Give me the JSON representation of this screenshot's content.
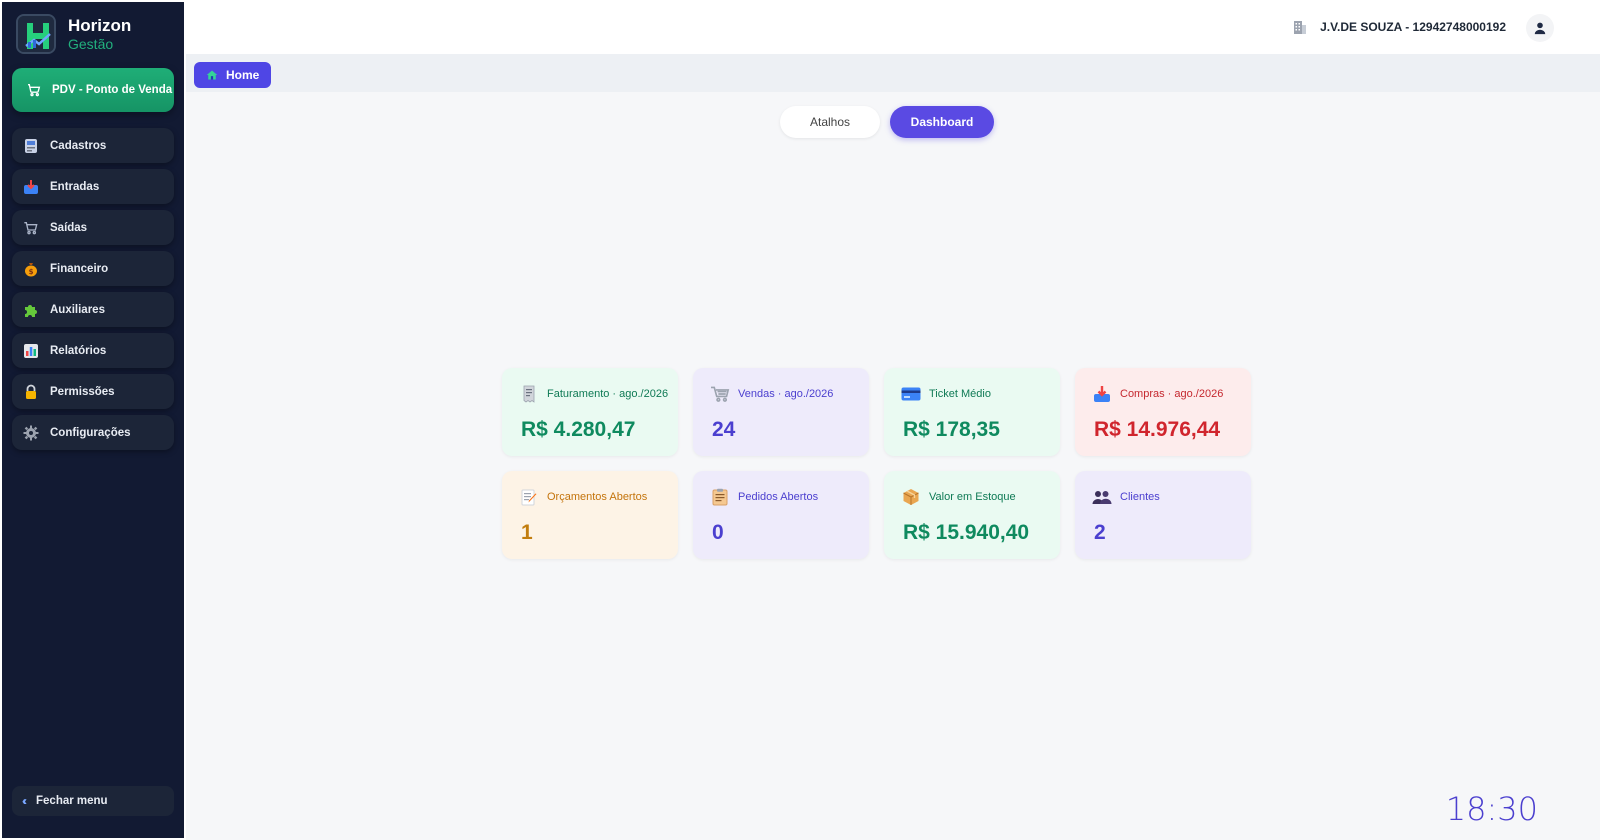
{
  "brand": {
    "name": "Horizon",
    "subtitle": "Gestão"
  },
  "sidebar": {
    "pdv_label": "PDV - Ponto de Venda",
    "items": [
      {
        "label": "Cadastros",
        "icon": "card-file-icon"
      },
      {
        "label": "Entradas",
        "icon": "inbox-icon"
      },
      {
        "label": "Saídas",
        "icon": "cart-icon"
      },
      {
        "label": "Financeiro",
        "icon": "money-bag-icon"
      },
      {
        "label": "Auxiliares",
        "icon": "puzzle-icon"
      },
      {
        "label": "Relatórios",
        "icon": "bar-chart-icon"
      },
      {
        "label": "Permissões",
        "icon": "lock-icon"
      },
      {
        "label": "Configurações",
        "icon": "gear-icon"
      }
    ],
    "close_label": "Fechar menu"
  },
  "topbar": {
    "company": "J.V.DE SOUZA - 12942748000192"
  },
  "breadcrumb": {
    "home_label": "Home"
  },
  "tabs": {
    "atalhos": "Atalhos",
    "dashboard": "Dashboard",
    "active": "Dashboard"
  },
  "cards": [
    {
      "label": "Faturamento · ago./2026",
      "value": "R$ 4.280,47",
      "icon": "receipt-icon",
      "color": "#0f8a5f"
    },
    {
      "label": "Vendas · ago./2026",
      "value": "24",
      "icon": "cart-icon",
      "color": "#4b3fcf"
    },
    {
      "label": "Ticket Médio",
      "value": "R$ 178,35",
      "icon": "credit-card-icon",
      "color": "#0f8a5f"
    },
    {
      "label": "Compras · ago./2026",
      "value": "R$ 14.976,44",
      "icon": "inbox-tray-icon",
      "color": "#d0252d"
    },
    {
      "label": "Orçamentos Abertos",
      "value": "1",
      "icon": "memo-icon",
      "color": "#c27d0e"
    },
    {
      "label": "Pedidos Abertos",
      "value": "0",
      "icon": "clipboard-icon",
      "color": "#4b3fcf"
    },
    {
      "label": "Valor em Estoque",
      "value": "R$ 15.940,40",
      "icon": "package-icon",
      "color": "#0f8a5f"
    },
    {
      "label": "Clientes",
      "value": "2",
      "icon": "users-icon",
      "color": "#4b3fcf"
    }
  ],
  "clock": "18:30"
}
